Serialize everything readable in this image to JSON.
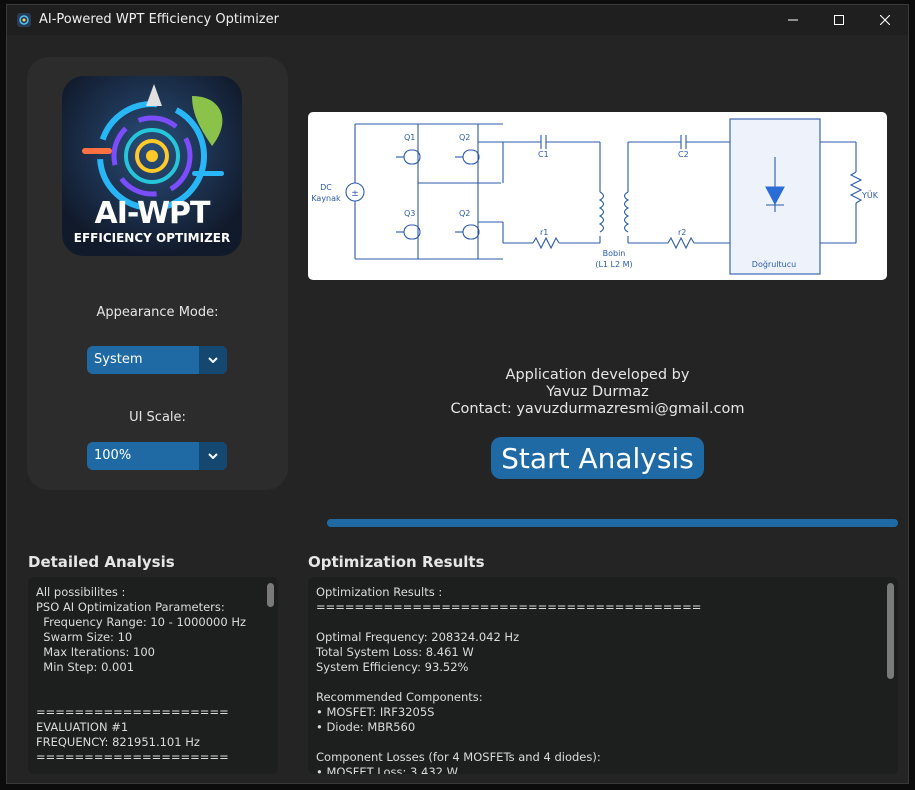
{
  "window": {
    "title": "AI-Powered WPT Efficiency Optimizer",
    "controls": {
      "minimize": "—",
      "maximize": "☐",
      "close": "✕"
    }
  },
  "sidebar": {
    "logo": {
      "main_text": "AI-WPT",
      "sub_text": "EFFICIENCY OPTIMIZER"
    },
    "appearance_label": "Appearance Mode:",
    "appearance_value": "System",
    "scale_label": "UI Scale:",
    "scale_value": "100%"
  },
  "circuit": {
    "q1": "Q1",
    "q2_top": "Q2",
    "q3": "Q3",
    "q2_bottom": "Q2",
    "source_line1": "DC",
    "source_line2": "Kaynak",
    "c1": "C1",
    "c2": "C2",
    "r1": "r1",
    "r2": "r2",
    "coil_line1": "Bobin",
    "coil_line2": "(L1 L2 M)",
    "rectifier": "Doğrultucu",
    "load": "YÜK"
  },
  "credits": {
    "line1": "Application developed by",
    "line2": "Yavuz Durmaz",
    "line3": "Contact: yavuzdurmazresmi@gmail.com"
  },
  "start_button": "Start Analysis",
  "progress": {
    "fraction": 1.0
  },
  "detailed": {
    "title": "Detailed Analysis",
    "text": "All possibilites :\nPSO AI Optimization Parameters:\n  Frequency Range: 10 - 1000000 Hz\n  Swarm Size: 10\n  Max Iterations: 100\n  Min Step: 0.001\n\n\n====================\nEVALUATION #1\nFREQUENCY: 821951.101 Hz\n===================="
  },
  "results": {
    "title": "Optimization Results",
    "text": "Optimization Results :\n========================================\n\nOptimal Frequency: 208324.042 Hz\nTotal System Loss: 8.461 W\nSystem Efficiency: 93.52%\n\nRecommended Components:\n• MOSFET: IRF3205S\n• Diode: MBR560\n\nComponent Losses (for 4 MOSFETs and 4 diodes):\n• MOSFET Loss: 3.432 W"
  },
  "colors": {
    "accent": "#1f6aa5",
    "accent_dark": "#144870",
    "background": "#242424",
    "schematic_line": "#2b5aa8"
  }
}
